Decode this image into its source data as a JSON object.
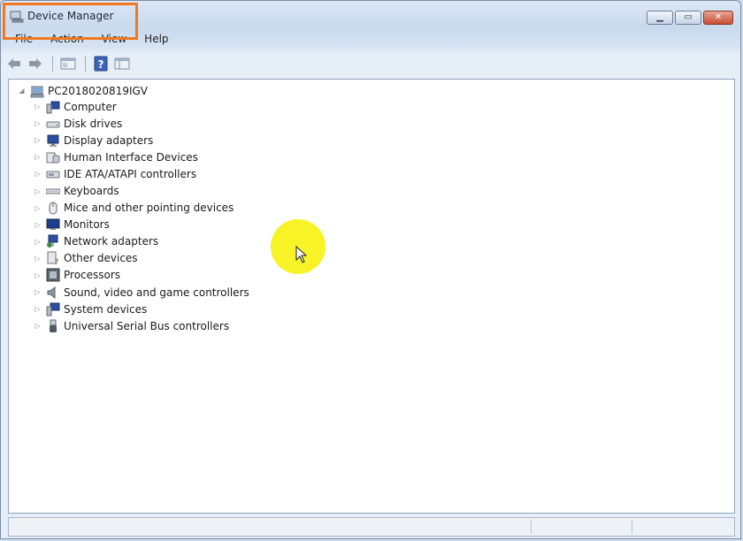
{
  "window": {
    "title": "Device Manager",
    "accent": "#f07820"
  },
  "menu": [
    "File",
    "Action",
    "View",
    "Help"
  ],
  "toolbar": [
    "back-icon",
    "forward-icon",
    "properties-icon",
    "help-icon",
    "view-icon"
  ],
  "tree": {
    "root": "PC2018020819IGV",
    "items": [
      {
        "label": "Computer",
        "icon": "computer-icon"
      },
      {
        "label": "Disk drives",
        "icon": "disk-drive-icon"
      },
      {
        "label": "Display adapters",
        "icon": "display-adapter-icon"
      },
      {
        "label": "Human Interface Devices",
        "icon": "hid-icon"
      },
      {
        "label": "IDE ATA/ATAPI controllers",
        "icon": "ide-controller-icon"
      },
      {
        "label": "Keyboards",
        "icon": "keyboard-icon"
      },
      {
        "label": "Mice and other pointing devices",
        "icon": "mouse-icon"
      },
      {
        "label": "Monitors",
        "icon": "monitor-icon"
      },
      {
        "label": "Network adapters",
        "icon": "network-adapter-icon"
      },
      {
        "label": "Other devices",
        "icon": "other-devices-icon"
      },
      {
        "label": "Processors",
        "icon": "processor-icon"
      },
      {
        "label": "Sound, video and game controllers",
        "icon": "sound-icon"
      },
      {
        "label": "System devices",
        "icon": "system-devices-icon"
      },
      {
        "label": "Universal Serial Bus controllers",
        "icon": "usb-icon"
      }
    ]
  }
}
